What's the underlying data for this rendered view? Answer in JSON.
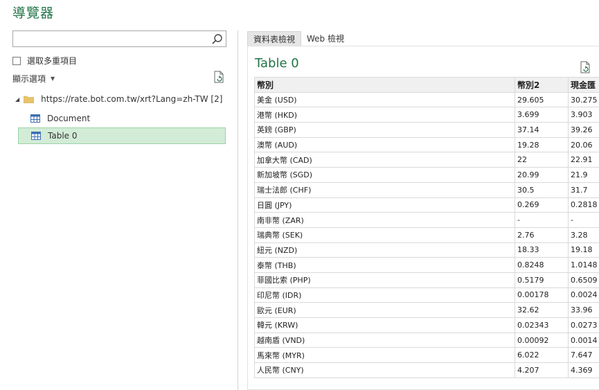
{
  "window": {
    "title": "導覽器"
  },
  "search": {
    "placeholder": "",
    "value": ""
  },
  "multi_select": {
    "label": "選取多重項目",
    "checked": false
  },
  "display_options": {
    "label": "顯示選項"
  },
  "tree": {
    "root": {
      "label": "https://rate.bot.com.tw/xrt?Lang=zh-TW [2]"
    },
    "items": [
      {
        "label": "Document",
        "selected": false
      },
      {
        "label": "Table 0",
        "selected": true
      }
    ]
  },
  "tabs": [
    {
      "label": "資料表檢視",
      "active": true
    },
    {
      "label": "Web 檢視",
      "active": false
    }
  ],
  "preview": {
    "title": "Table 0",
    "columns": [
      "幣別",
      "幣別2",
      "現金匯"
    ],
    "rows": [
      [
        "美金 (USD)",
        "29.605",
        "30.275"
      ],
      [
        "港幣 (HKD)",
        "3.699",
        "3.903"
      ],
      [
        "英鎊 (GBP)",
        "37.14",
        "39.26"
      ],
      [
        "澳幣 (AUD)",
        "19.28",
        "20.06"
      ],
      [
        "加拿大幣 (CAD)",
        "22",
        "22.91"
      ],
      [
        "新加坡幣 (SGD)",
        "20.99",
        "21.9"
      ],
      [
        "瑞士法郎 (CHF)",
        "30.5",
        "31.7"
      ],
      [
        "日圓 (JPY)",
        "0.269",
        "0.2818"
      ],
      [
        "南非幣 (ZAR)",
        "-",
        "-"
      ],
      [
        "瑞典幣 (SEK)",
        "2.76",
        "3.28"
      ],
      [
        "紐元 (NZD)",
        "18.33",
        "19.18"
      ],
      [
        "泰幣 (THB)",
        "0.8248",
        "1.0148"
      ],
      [
        "菲國比索 (PHP)",
        "0.5179",
        "0.6509"
      ],
      [
        "印尼幣 (IDR)",
        "0.00178",
        "0.0024"
      ],
      [
        "歐元 (EUR)",
        "32.62",
        "33.96"
      ],
      [
        "韓元 (KRW)",
        "0.02343",
        "0.0273"
      ],
      [
        "越南盾 (VND)",
        "0.00092",
        "0.0014"
      ],
      [
        "馬來幣 (MYR)",
        "6.022",
        "7.647"
      ],
      [
        "人民幣 (CNY)",
        "4.207",
        "4.369"
      ]
    ]
  },
  "colors": {
    "accent": "#217346",
    "selected_bg": "#d3ecd7"
  }
}
